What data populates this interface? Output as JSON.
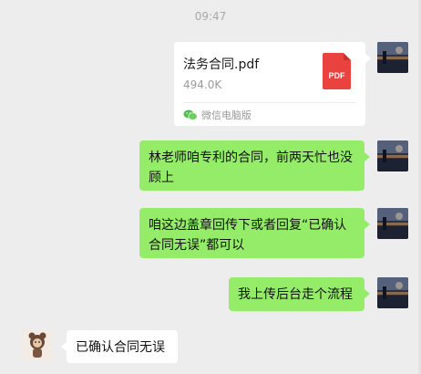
{
  "timestamp": "09:47",
  "file_message": {
    "name": "法务合同.pdf",
    "size": "494.0K",
    "icon_label": "PDF",
    "source": "微信电脑版",
    "icon": "pdf-file-icon",
    "source_icon": "wechat-icon"
  },
  "messages": [
    {
      "sender": "me",
      "text": "林老师咱专利的合同，前两天忙也没顾上"
    },
    {
      "sender": "me",
      "text": "咱这边盖章回传下或者回复“已确认合同无误”都可以"
    },
    {
      "sender": "me",
      "text": "我上传后台走个流程"
    },
    {
      "sender": "other",
      "text": "已确认合同无误"
    }
  ],
  "colors": {
    "background": "#ededed",
    "my_bubble": "#95ec69",
    "other_bubble": "#ffffff",
    "pdf_red": "#e9423f"
  }
}
